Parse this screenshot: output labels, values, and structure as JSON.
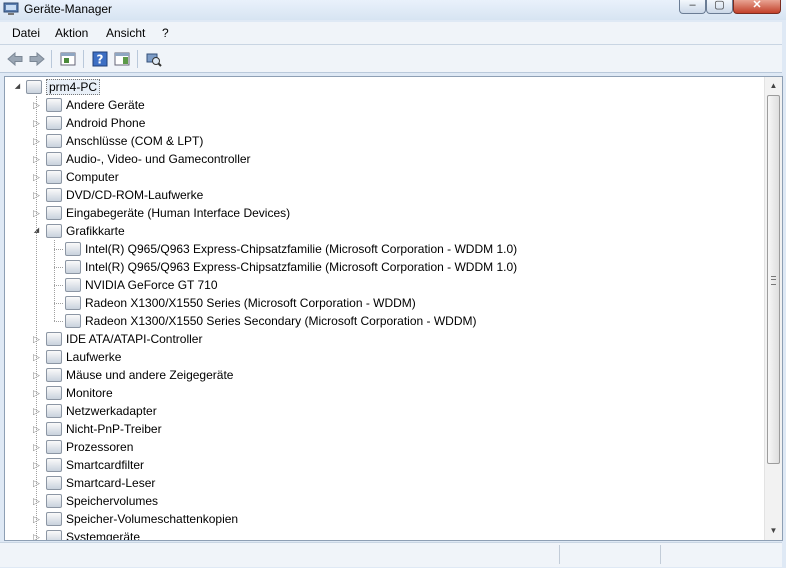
{
  "window": {
    "title": "Geräte-Manager"
  },
  "menubar": [
    "Datei",
    "Aktion",
    "Ansicht",
    "?"
  ],
  "toolbar": [
    {
      "icon": "back-arrow-icon"
    },
    {
      "icon": "forward-arrow-icon"
    },
    {
      "icon": "properties-icon"
    },
    {
      "icon": "help-icon"
    },
    {
      "icon": "show-hide-console-icon"
    },
    {
      "icon": "scan-hardware-icon"
    }
  ],
  "tree": {
    "root": "prm4-PC",
    "categories": [
      {
        "label": "Andere Geräte",
        "icon": "unknown-device-icon"
      },
      {
        "label": "Android Phone",
        "icon": "phone-icon"
      },
      {
        "label": "Anschlüsse (COM & LPT)",
        "icon": "port-icon"
      },
      {
        "label": "Audio-, Video- und Gamecontroller",
        "icon": "speaker-icon"
      },
      {
        "label": "Computer",
        "icon": "computer-icon"
      },
      {
        "label": "DVD/CD-ROM-Laufwerke",
        "icon": "dvd-drive-icon"
      },
      {
        "label": "Eingabegeräte (Human Interface Devices)",
        "icon": "hid-icon"
      },
      {
        "label": "Grafikkarte",
        "icon": "display-adapter-icon",
        "expanded": true,
        "children": [
          "Intel(R) Q965/Q963 Express-Chipsatzfamilie (Microsoft Corporation - WDDM 1.0)",
          "Intel(R) Q965/Q963 Express-Chipsatzfamilie (Microsoft Corporation - WDDM 1.0)",
          "NVIDIA GeForce GT 710",
          "Radeon X1300/X1550 Series (Microsoft Corporation - WDDM)",
          "Radeon X1300/X1550 Series Secondary (Microsoft Corporation - WDDM)"
        ]
      },
      {
        "label": "IDE ATA/ATAPI-Controller",
        "icon": "ide-controller-icon"
      },
      {
        "label": "Laufwerke",
        "icon": "disk-drive-icon"
      },
      {
        "label": "Mäuse und andere Zeigegeräte",
        "icon": "mouse-icon"
      },
      {
        "label": "Monitore",
        "icon": "monitor-icon"
      },
      {
        "label": "Netzwerkadapter",
        "icon": "network-adapter-icon"
      },
      {
        "label": "Nicht-PnP-Treiber",
        "icon": "non-pnp-driver-icon"
      },
      {
        "label": "Prozessoren",
        "icon": "processor-icon"
      },
      {
        "label": "Smartcardfilter",
        "icon": "smartcard-icon"
      },
      {
        "label": "Smartcard-Leser",
        "icon": "smartcard-reader-icon"
      },
      {
        "label": "Speichervolumes",
        "icon": "storage-volume-icon"
      },
      {
        "label": "Speicher-Volumeschattenkopien",
        "icon": "shadow-copy-icon"
      },
      {
        "label": "Systemgeräte",
        "icon": "system-device-icon"
      }
    ]
  }
}
